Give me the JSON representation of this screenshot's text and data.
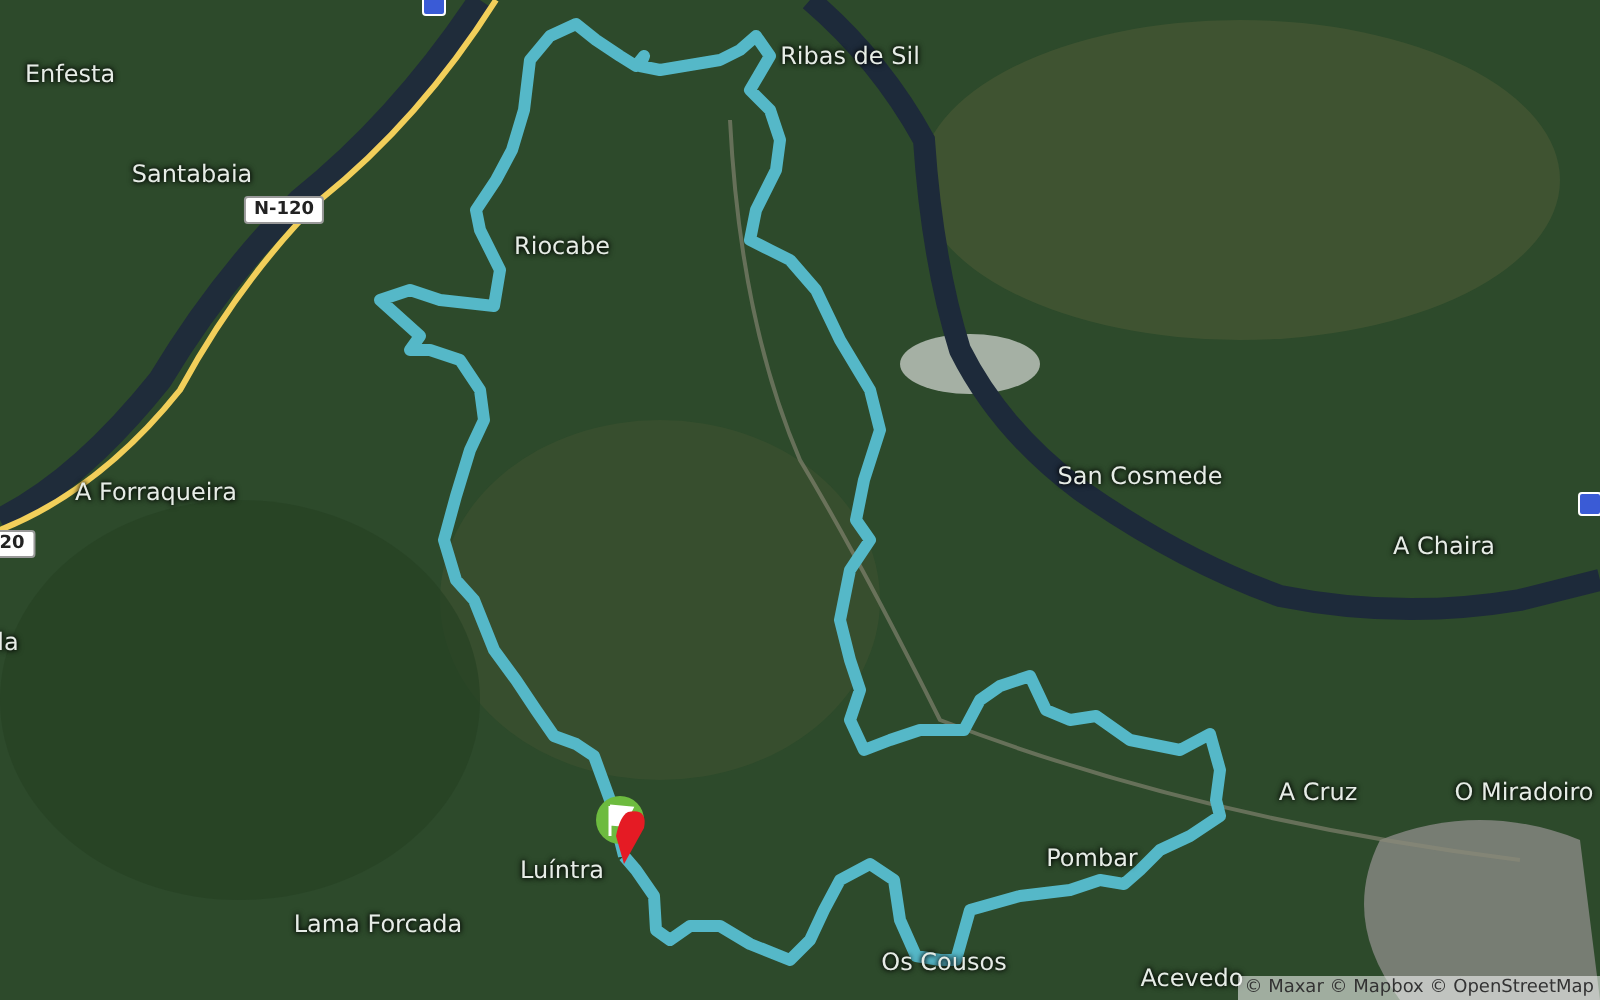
{
  "map": {
    "place_labels": [
      {
        "label": "Enfesta"
      },
      {
        "label": "Santabaia"
      },
      {
        "label": "Riocabe"
      },
      {
        "label": "Ribas de Sil"
      },
      {
        "label": "A Forraqueira"
      },
      {
        "label": "San Cosmede"
      },
      {
        "label": "A Chaira"
      },
      {
        "label": "la"
      },
      {
        "label": "A Cruz"
      },
      {
        "label": "O Miradoiro"
      },
      {
        "label": "Luíntra"
      },
      {
        "label": "Pombar"
      },
      {
        "label": "Lama Forcada"
      },
      {
        "label": "Os Cousos"
      },
      {
        "label": "Acevedo"
      }
    ],
    "road_shields": [
      {
        "label": "N-120"
      },
      {
        "label": "20"
      }
    ],
    "attribution": "© Maxar © Mapbox © OpenStreetMap"
  }
}
